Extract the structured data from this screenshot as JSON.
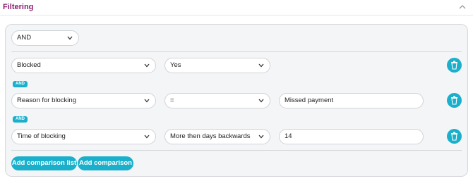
{
  "section": {
    "title": "Filtering"
  },
  "icons": {
    "collapse": "chevron-up-icon",
    "dropdown": "chevron-down-icon",
    "delete": "trash-icon"
  },
  "colors": {
    "accent": "#1ab0cb",
    "title": "#8a1d6e"
  },
  "logic_operator": {
    "value": "AND"
  },
  "conditions": [
    {
      "field": "Blocked",
      "operator": "Yes",
      "value": null
    },
    {
      "connector": "AND",
      "field": "Reason for blocking",
      "operator": "=",
      "value": "Missed payment"
    },
    {
      "connector": "AND",
      "field": "Time of blocking",
      "operator": "More then days backwards",
      "value": "14"
    }
  ],
  "actions": {
    "add_comparison_list": "Add comparison list",
    "add_comparison": "Add comparison"
  }
}
